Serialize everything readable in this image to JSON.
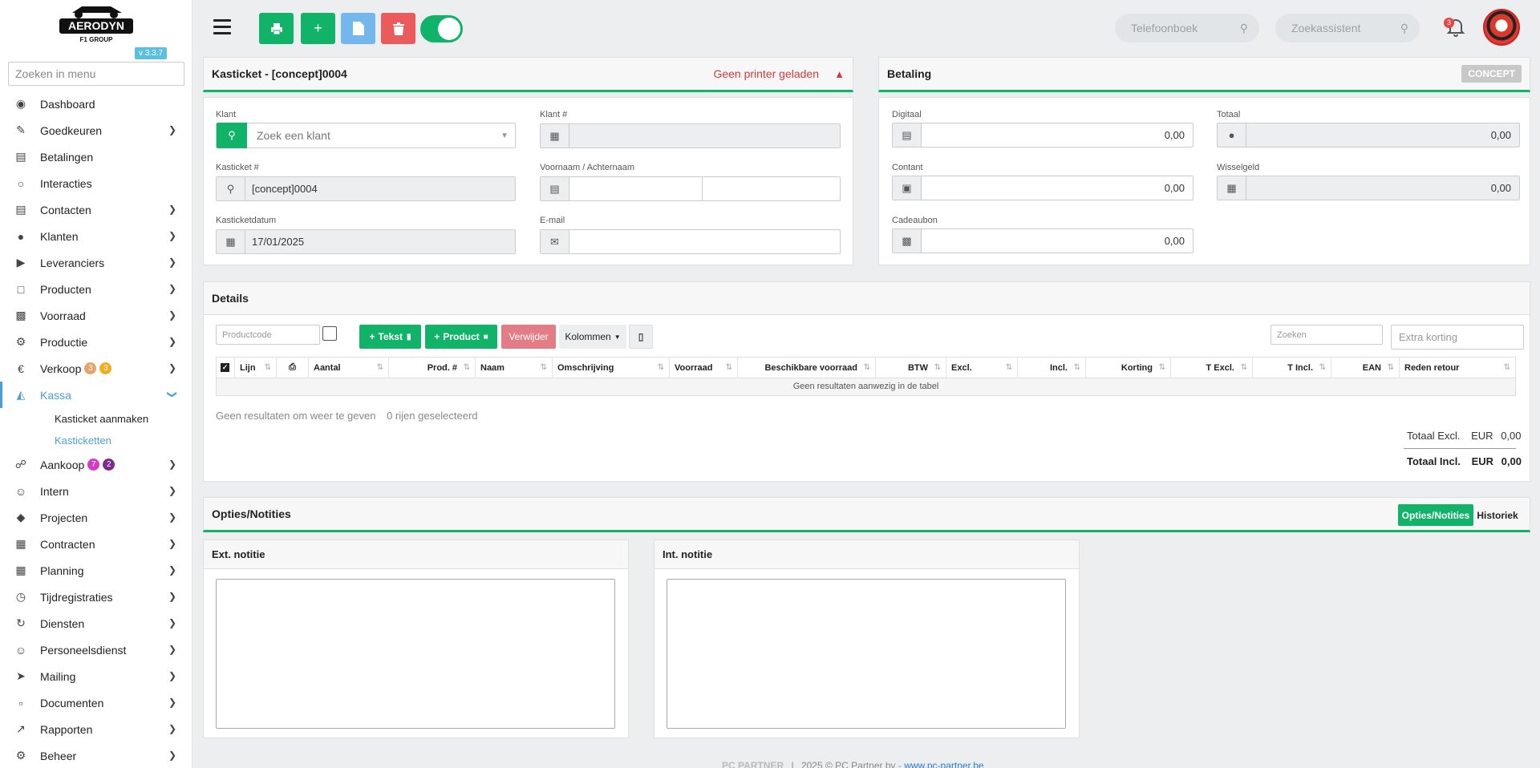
{
  "app": {
    "brand": "AERODYN",
    "brand_sub": "F1 GROUP",
    "version": "v 3.3.7"
  },
  "menu_search": {
    "placeholder": "Zoeken in menu"
  },
  "sidebar": {
    "items": [
      {
        "label": "Dashboard",
        "icon": "dashboard-icon"
      },
      {
        "label": "Goedkeuren",
        "icon": "user-check-icon"
      },
      {
        "label": "Betalingen",
        "icon": "credit-card-icon"
      },
      {
        "label": "Interacties",
        "icon": "chat-icon"
      },
      {
        "label": "Contacten",
        "icon": "contact-card-icon"
      },
      {
        "label": "Klanten",
        "icon": "customer-icon"
      },
      {
        "label": "Leveranciers",
        "icon": "truck-icon"
      },
      {
        "label": "Producten",
        "icon": "box-icon"
      },
      {
        "label": "Voorraad",
        "icon": "boxes-icon"
      },
      {
        "label": "Productie",
        "icon": "cogs-icon"
      },
      {
        "label": "Verkoop",
        "icon": "euro-icon",
        "badges": [
          "3",
          "3"
        ]
      },
      {
        "label": "Kassa",
        "icon": "basket-icon"
      },
      {
        "label": "Aankoop",
        "icon": "cart-icon",
        "badges": [
          "7",
          "2"
        ]
      },
      {
        "label": "Intern",
        "icon": "users-icon"
      },
      {
        "label": "Projecten",
        "icon": "project-icon"
      },
      {
        "label": "Contracten",
        "icon": "contract-icon"
      },
      {
        "label": "Planning",
        "icon": "calendar-icon"
      },
      {
        "label": "Tijdregistraties",
        "icon": "clock-history-icon"
      },
      {
        "label": "Diensten",
        "icon": "refresh-icon"
      },
      {
        "label": "Personeelsdienst",
        "icon": "staff-icon"
      },
      {
        "label": "Mailing",
        "icon": "paper-plane-icon"
      },
      {
        "label": "Documenten",
        "icon": "folder-icon"
      },
      {
        "label": "Rapporten",
        "icon": "chart-line-icon"
      },
      {
        "label": "Beheer",
        "icon": "settings-icon"
      }
    ],
    "kassa_sub": [
      "Kasticket aanmaken",
      "Kasticketten"
    ],
    "colors": {
      "badge_orange": "#e8a36a",
      "badge_yellow": "#f0ad20",
      "badge_magenta": "#d63bc8",
      "badge_purple": "#7a2c8e",
      "active": "#4a9fdb"
    }
  },
  "topbar": {
    "search1_placeholder": "Telefoonboek",
    "search2_placeholder": "Zoekassistent",
    "notification_count": "3"
  },
  "ticket": {
    "title": "Kasticket - [concept]0004",
    "warning": "Geen printer geladen",
    "klant_label": "Klant",
    "klant_placeholder": "Zoek een klant",
    "klantnr_label": "Klant #",
    "kasticketnr_label": "Kasticket #",
    "kasticketnr_value": "[concept]0004",
    "naam_label": "Voornaam / Achternaam",
    "datum_label": "Kasticketdatum",
    "datum_value": "17/01/2025",
    "email_label": "E-mail"
  },
  "betaling": {
    "title": "Betaling",
    "status": "CONCEPT",
    "digitaal_label": "Digitaal",
    "digitaal_value": "0,00",
    "totaal_label": "Totaal",
    "totaal_value": "0,00",
    "contant_label": "Contant",
    "contant_value": "0,00",
    "wisselgeld_label": "Wisselgeld",
    "wisselgeld_value": "0,00",
    "cadeaubon_label": "Cadeaubon",
    "cadeaubon_value": "0,00"
  },
  "details": {
    "title": "Details",
    "productcode_placeholder": "Productcode",
    "btn_tekst": "Tekst",
    "btn_product": "Product",
    "btn_verwijder": "Verwijder",
    "btn_kolommen": "Kolommen",
    "search_placeholder": "Zoeken",
    "korting_placeholder": "Extra korting",
    "columns": [
      "Lijn",
      "",
      "Aantal",
      "Prod. #",
      "Naam",
      "Omschrijving",
      "Voorraad",
      "Beschikbare voorraad",
      "BTW",
      "Excl.",
      "Incl.",
      "Korting",
      "T Excl.",
      "T Incl.",
      "EAN",
      "Reden retour"
    ],
    "empty_row": "Geen resultaten aanwezig in de tabel",
    "info_results": "Geen resultaten om weer te geven",
    "info_selected": "0 rijen geselecteerd",
    "totaal_excl_label": "Totaal Excl.",
    "totaal_incl_label": "Totaal Incl.",
    "currency": "EUR",
    "totaal_excl_value": "0,00",
    "totaal_incl_value": "0,00"
  },
  "opties": {
    "title": "Opties/Notities",
    "tab_active": "Opties/Notities",
    "tab_other": "Historiek",
    "ext_title": "Ext. notitie",
    "int_title": "Int. notitie"
  },
  "footer": {
    "brand": "PC PARTNER",
    "text": "2025 © PC Partner bv -",
    "link": "www.pc-partner.be"
  },
  "colors": {
    "green": "#11b369",
    "blue_btn": "#74b7ec",
    "red_btn": "#ec5b5b",
    "warning": "#d33a3a",
    "verwijder": "#e47c85"
  }
}
